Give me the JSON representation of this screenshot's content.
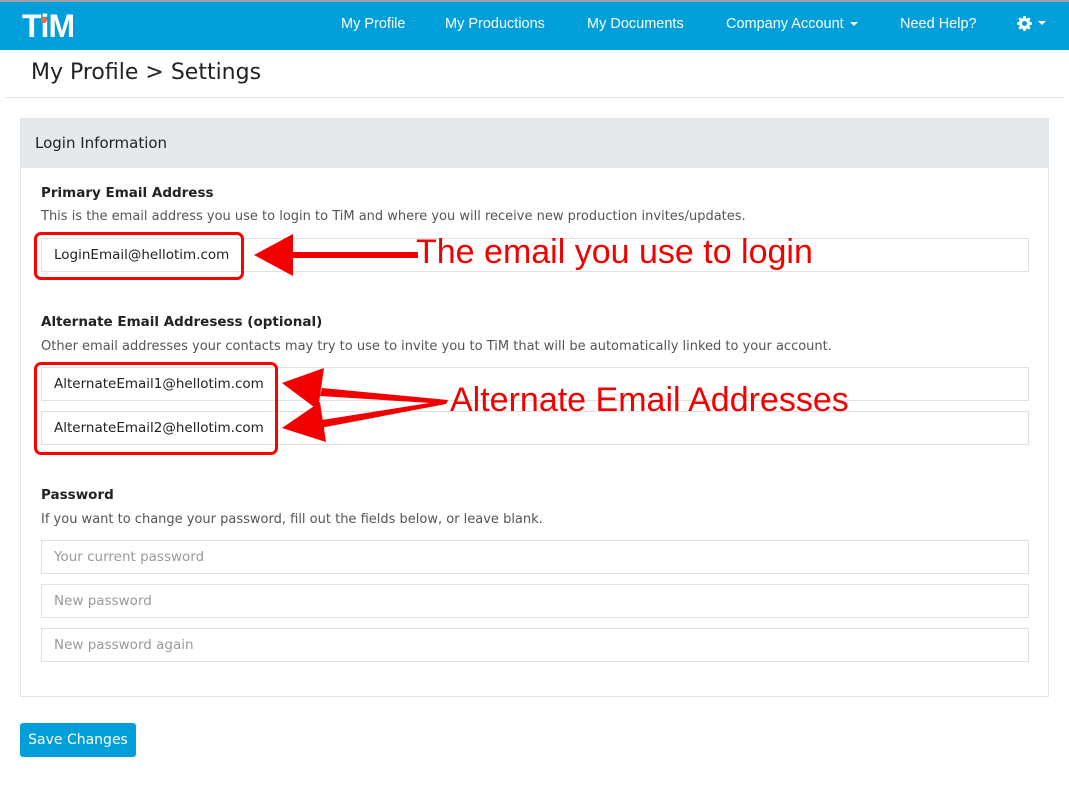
{
  "app": {
    "logo_text": "TiM"
  },
  "nav": {
    "items": [
      {
        "label": "My Profile"
      },
      {
        "label": "My Productions"
      },
      {
        "label": "My Documents"
      },
      {
        "label": "Company Account"
      },
      {
        "label": "Need Help?"
      }
    ],
    "settings_icon": "gear-icon"
  },
  "breadcrumb": {
    "text": "My Profile > Settings"
  },
  "panel": {
    "title": "Login Information",
    "primary": {
      "label": "Primary Email Address",
      "help": "This is the email address you use to login to TiM and where you will receive new production invites/updates.",
      "value": "LoginEmail@hellotim.com"
    },
    "alternate": {
      "label": "Alternate Email Addresess (optional)",
      "help": "Other email addresses your contacts may try to use to invite you to TiM that will be automatically linked to your account.",
      "values": [
        "AlternateEmail1@hellotim.com",
        "AlternateEmail2@hellotim.com"
      ]
    },
    "password": {
      "label": "Password",
      "help": "If you want to change your password, fill out the fields below, or leave blank.",
      "placeholders": [
        "Your current password",
        "New password",
        "New password again"
      ]
    }
  },
  "save_label": "Save Changes",
  "annotations": {
    "login": "The email you use to login",
    "alternate": "Alternate Email Addresses",
    "color": "#f20000"
  },
  "colors": {
    "brand": "#009fd9",
    "logo_dot": "#f06a3a"
  }
}
